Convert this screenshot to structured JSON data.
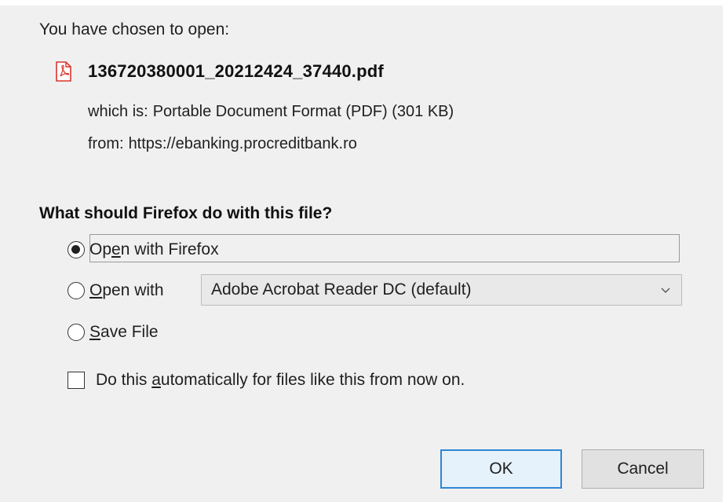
{
  "dialog": {
    "intro": "You have chosen to open:",
    "file": {
      "name": "136720380001_20212424_37440.pdf",
      "icon": "pdf-file-icon",
      "type_label": "which is:",
      "type_value": "Portable Document Format (PDF) (301 KB)",
      "from_label": "from:",
      "from_value": "https://ebanking.procreditbank.ro"
    },
    "question": "What should Firefox do with this file?",
    "options": {
      "open_with_firefox": {
        "label_pre": "Op",
        "label_accel": "e",
        "label_post": "n with Firefox",
        "selected": true
      },
      "open_with": {
        "label_pre": "",
        "label_accel": "O",
        "label_post": "pen with",
        "selected": false,
        "app_selected": "Adobe Acrobat Reader DC (default)"
      },
      "save_file": {
        "label_pre": "",
        "label_accel": "S",
        "label_post": "ave File",
        "selected": false
      }
    },
    "auto": {
      "label_pre": "Do this ",
      "label_accel": "a",
      "label_post": "utomatically for files like this from now on.",
      "checked": false
    },
    "buttons": {
      "ok": "OK",
      "cancel": "Cancel"
    },
    "colors": {
      "background": "#f0f0f0",
      "ok_border": "#2f86d6",
      "ok_fill": "#e5f1fb",
      "pdf_icon": "#d9342b"
    }
  }
}
